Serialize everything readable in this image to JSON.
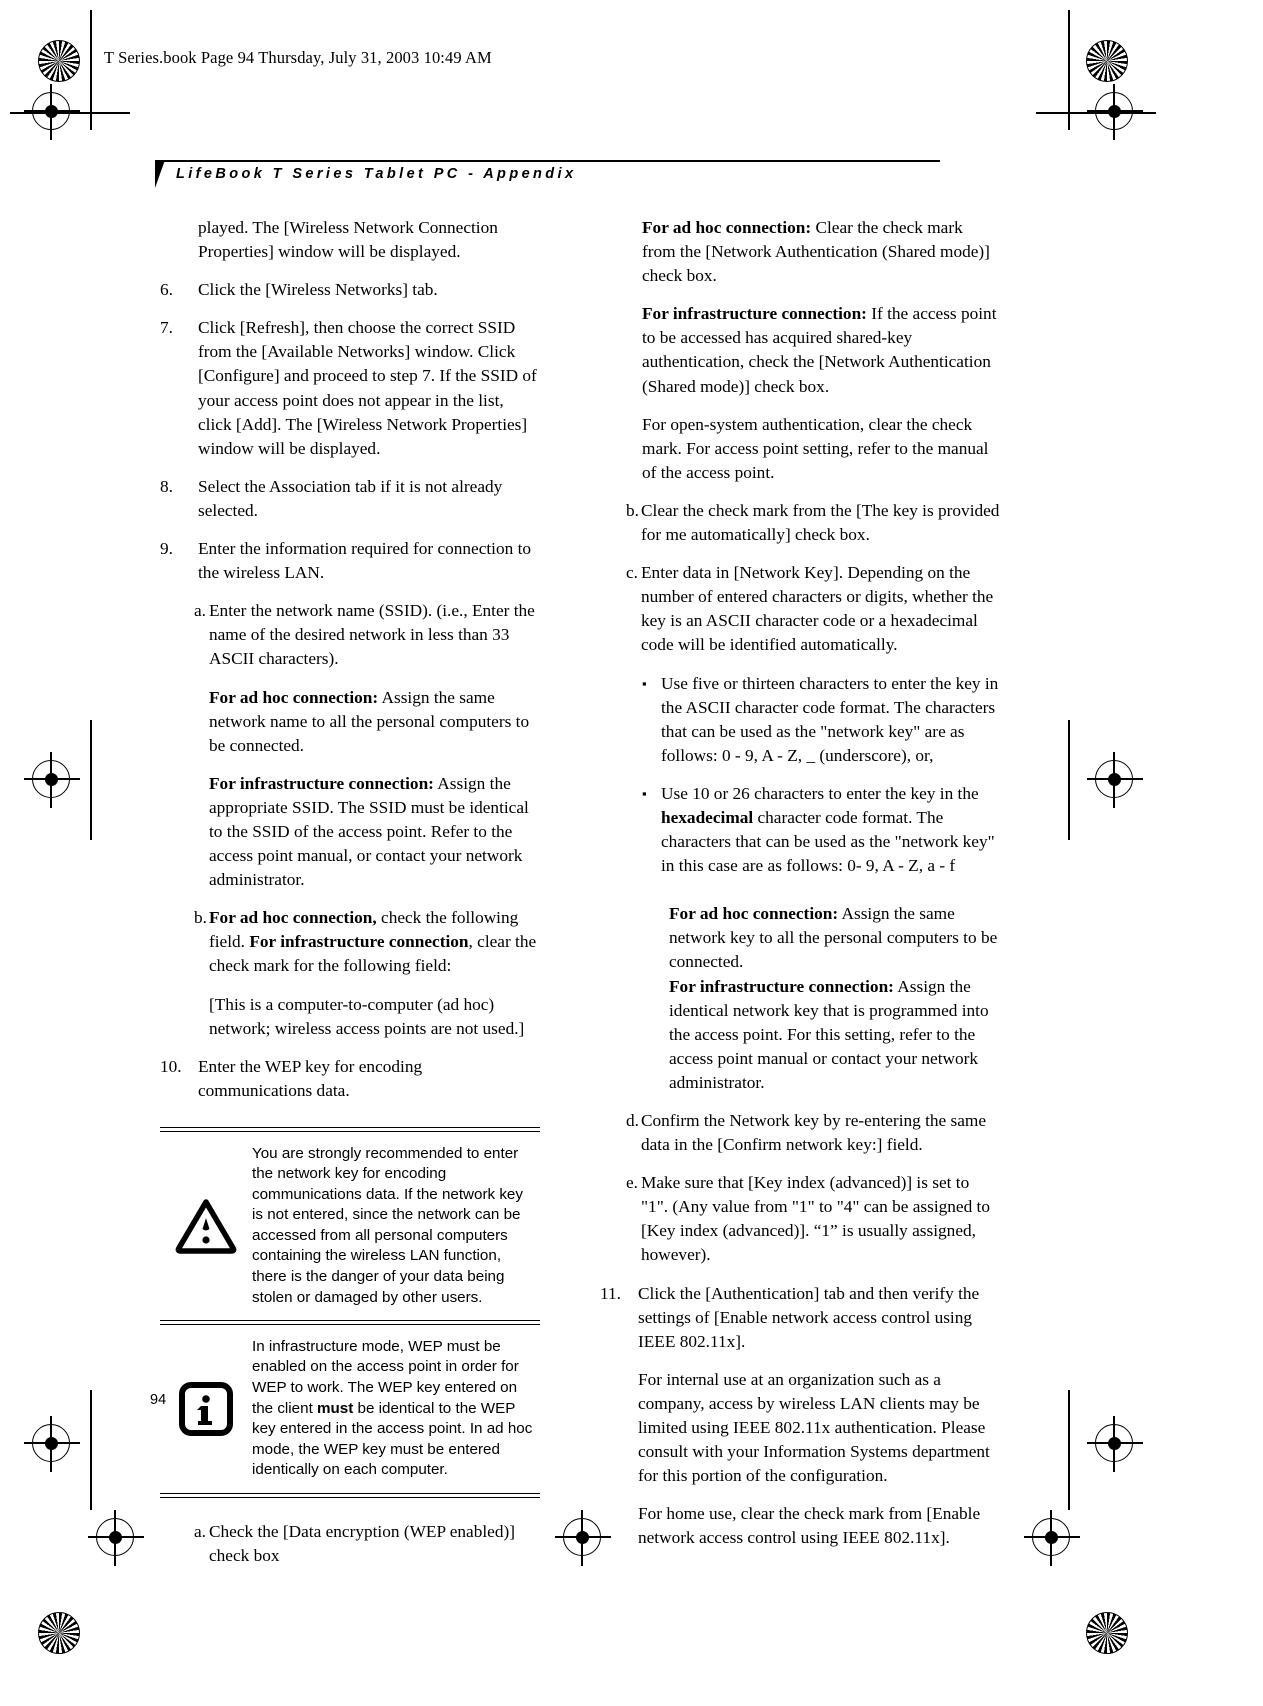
{
  "page": {
    "file_header": "T Series.book  Page 94  Thursday, July 31, 2003  10:49 AM",
    "running_title": "LifeBook T Series Tablet PC - Appendix",
    "folio": "94"
  },
  "left_column": {
    "continued_paragraph": "played. The [Wireless Network Connection Properties] window will be displayed.",
    "steps": [
      {
        "number": "6.",
        "text": "Click the [Wireless Networks] tab."
      },
      {
        "number": "7.",
        "text": "Click [Refresh], then choose the correct SSID from the [Available Networks] window. Click [Configure] and proceed to step 7. If the SSID of your access point does not appear in the list, click [Add]. The [Wireless Network Properties] window will be displayed."
      },
      {
        "number": "8.",
        "text": "Select the Association tab if it is not already selected."
      },
      {
        "number": "9.",
        "text": "Enter the information required for connection to the wireless LAN."
      }
    ],
    "sub_a": {
      "mark": "a.",
      "text": "Enter the network name (SSID). (i.e., Enter the name of the desired network in less than 33 ASCII characters)."
    },
    "ad_hoc_label": "For ad hoc connection:",
    "ad_hoc_text": " Assign the same network name to all the personal computers to be connected.",
    "infra_label": "For infrastructure connection:",
    "infra_text": " Assign the appropriate SSID. The SSID must be identical to the SSID of the access point. Refer to the access point manual, or contact your network administrator.",
    "sub_b": {
      "mark": "b.",
      "bold_1": "For ad hoc connection,",
      "text_1": " check the following field.",
      "bold_2": "For infrastructure connection",
      "text_2": ", clear the check mark for the following field:"
    },
    "bracket_note": "[This is a computer-to-computer (ad hoc) network; wireless access points are not used.]",
    "step_10": {
      "number": "10.",
      "text": "Enter the WEP key for encoding communications data."
    },
    "caution_note": {
      "icon": "warning-triangle-icon",
      "text": "You are strongly recommended to enter the network key for encoding communications data. If the network key is not entered, since the network can be accessed from all personal computers containing the wireless LAN function, there is the danger of your data being stolen or damaged by other users."
    },
    "info_note": {
      "icon": "information-icon",
      "text_1": "In infrastructure mode, WEP must be enabled on the access point in order for WEP to work. The WEP key entered on the client ",
      "bold": "must",
      "text_2": " be identical to the WEP key entered in the access point. In ad hoc mode, the WEP key must be entered identically on each computer."
    },
    "final_sub_a": {
      "mark": "a.",
      "text": "Check the [Data encryption (WEP enabled)] check box"
    }
  },
  "right_column": {
    "ad_hoc_label": "For ad hoc connection:",
    "ad_hoc_text": " Clear the check mark from the [Network Authentication (Shared mode)] check box.",
    "infra_label": "For infrastructure connection:",
    "infra_text": " If the access point to be accessed has acquired shared-key authentication, check the [Network Authentication (Shared mode)] check box.",
    "open_system_text": "For open-system authentication, clear the check mark. For access point setting, refer to the manual of the access point.",
    "sub_b": {
      "mark": "b.",
      "text": "Clear the check mark from the [The key is provided for me automatically] check box."
    },
    "sub_c": {
      "mark": "c.",
      "text": "Enter data in [Network Key]. Depending on the number of entered characters or digits, whether the key is an ASCII character code or a hexadecimal code will be identified automatically."
    },
    "bullets": [
      {
        "mark": "▪",
        "text": "Use five or thirteen characters to enter the key in the ASCII character code format. The characters that can be used as the \"network key\" are as follows: 0 - 9, A - Z, _ (underscore), or,"
      }
    ],
    "bullet_2": {
      "mark": "▪",
      "text_1": "Use 10 or 26 characters to enter the key in the ",
      "bold": "hexadecimal",
      "text_2": " character code format. The characters that can be used as the \"network key\" in this case are as follows: 0- 9, A - Z, a - f"
    },
    "ad_hoc_label_2": "For ad hoc connection:",
    "ad_hoc_text_2": " Assign the same network key to all the personal computers to be connected.",
    "infra_label_2": "For infrastructure connection:",
    "infra_text_2": " Assign the identical network key that is programmed into the access point. For this setting, refer to the access point manual or contact your network administrator.",
    "sub_d": {
      "mark": "d.",
      "text": "Confirm the Network key by re-entering the same data in the [Confirm network key:] field."
    },
    "sub_e": {
      "mark": "e.",
      "text": "Make sure that [Key index (advanced)] is set to \"1\". (Any value from \"1\" to \"4\" can be assigned to [Key index (advanced)]. “1” is usually assigned, however)."
    },
    "step_11": {
      "number": "11.",
      "text": "Click the [Authentication] tab and then verify the settings of [Enable network access control using IEEE 802.11x]."
    },
    "internal_use_text": "For internal use at an organization such as a company, access by wireless LAN clients may be limited using IEEE 802.11x authentication. Please consult with your Information Systems department for this portion of the configuration.",
    "home_use_text": "For home use, clear the check mark from [Enable network access control using IEEE 802.11x]."
  }
}
